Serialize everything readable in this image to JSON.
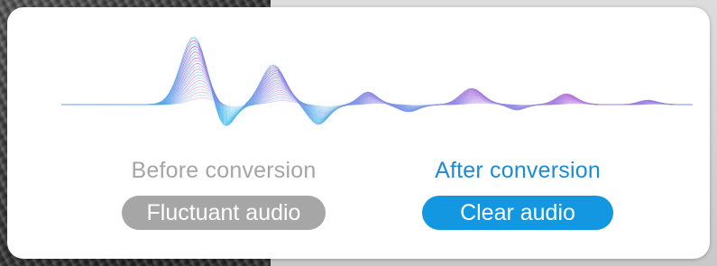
{
  "colors": {
    "before_text": "#a5a5a5",
    "before_pill": "#a6a6a6",
    "after_text": "#1a8bd6",
    "after_pill": "#1297e0",
    "wave_pink": "#e040c8",
    "wave_cyan": "#35c8f0"
  },
  "before": {
    "caption": "Before conversion",
    "pill_label": "Fluctuant audio"
  },
  "after": {
    "caption": "After conversion",
    "pill_label": "Clear audio"
  }
}
